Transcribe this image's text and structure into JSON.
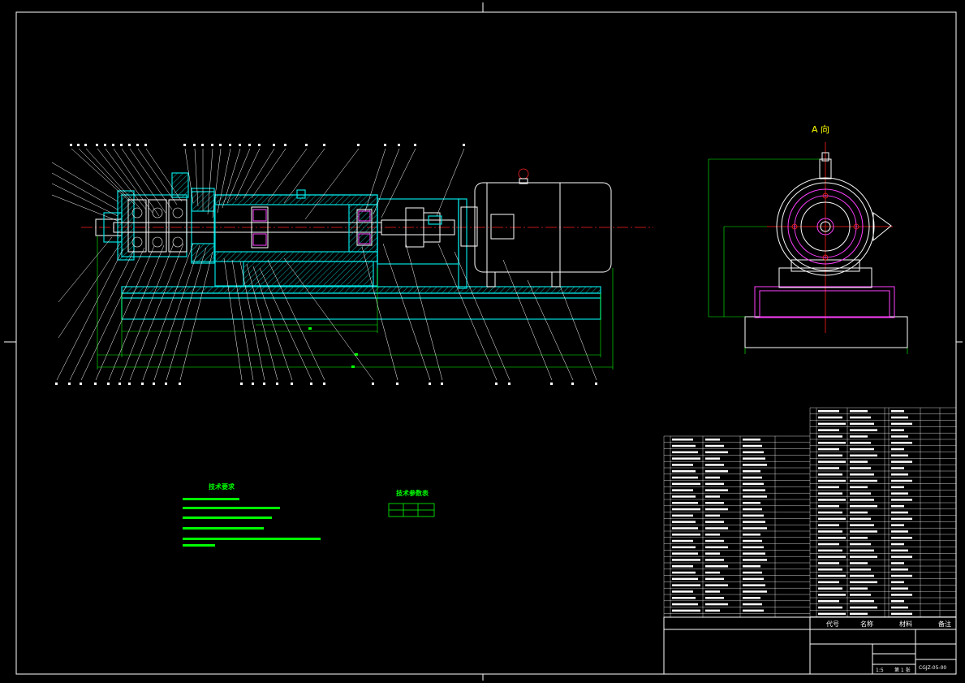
{
  "view_label": "A 向",
  "tech_requirements": {
    "title": "技术要求"
  },
  "tech_params": {
    "title": "技术参数表"
  },
  "title_block": {
    "drawing_number": "CGJZ-05-00",
    "header_code": "代号",
    "header_name": "名称",
    "header_material": "材料",
    "header_remark": "备注",
    "scale": "1:5",
    "sheet": "第 1 张"
  }
}
